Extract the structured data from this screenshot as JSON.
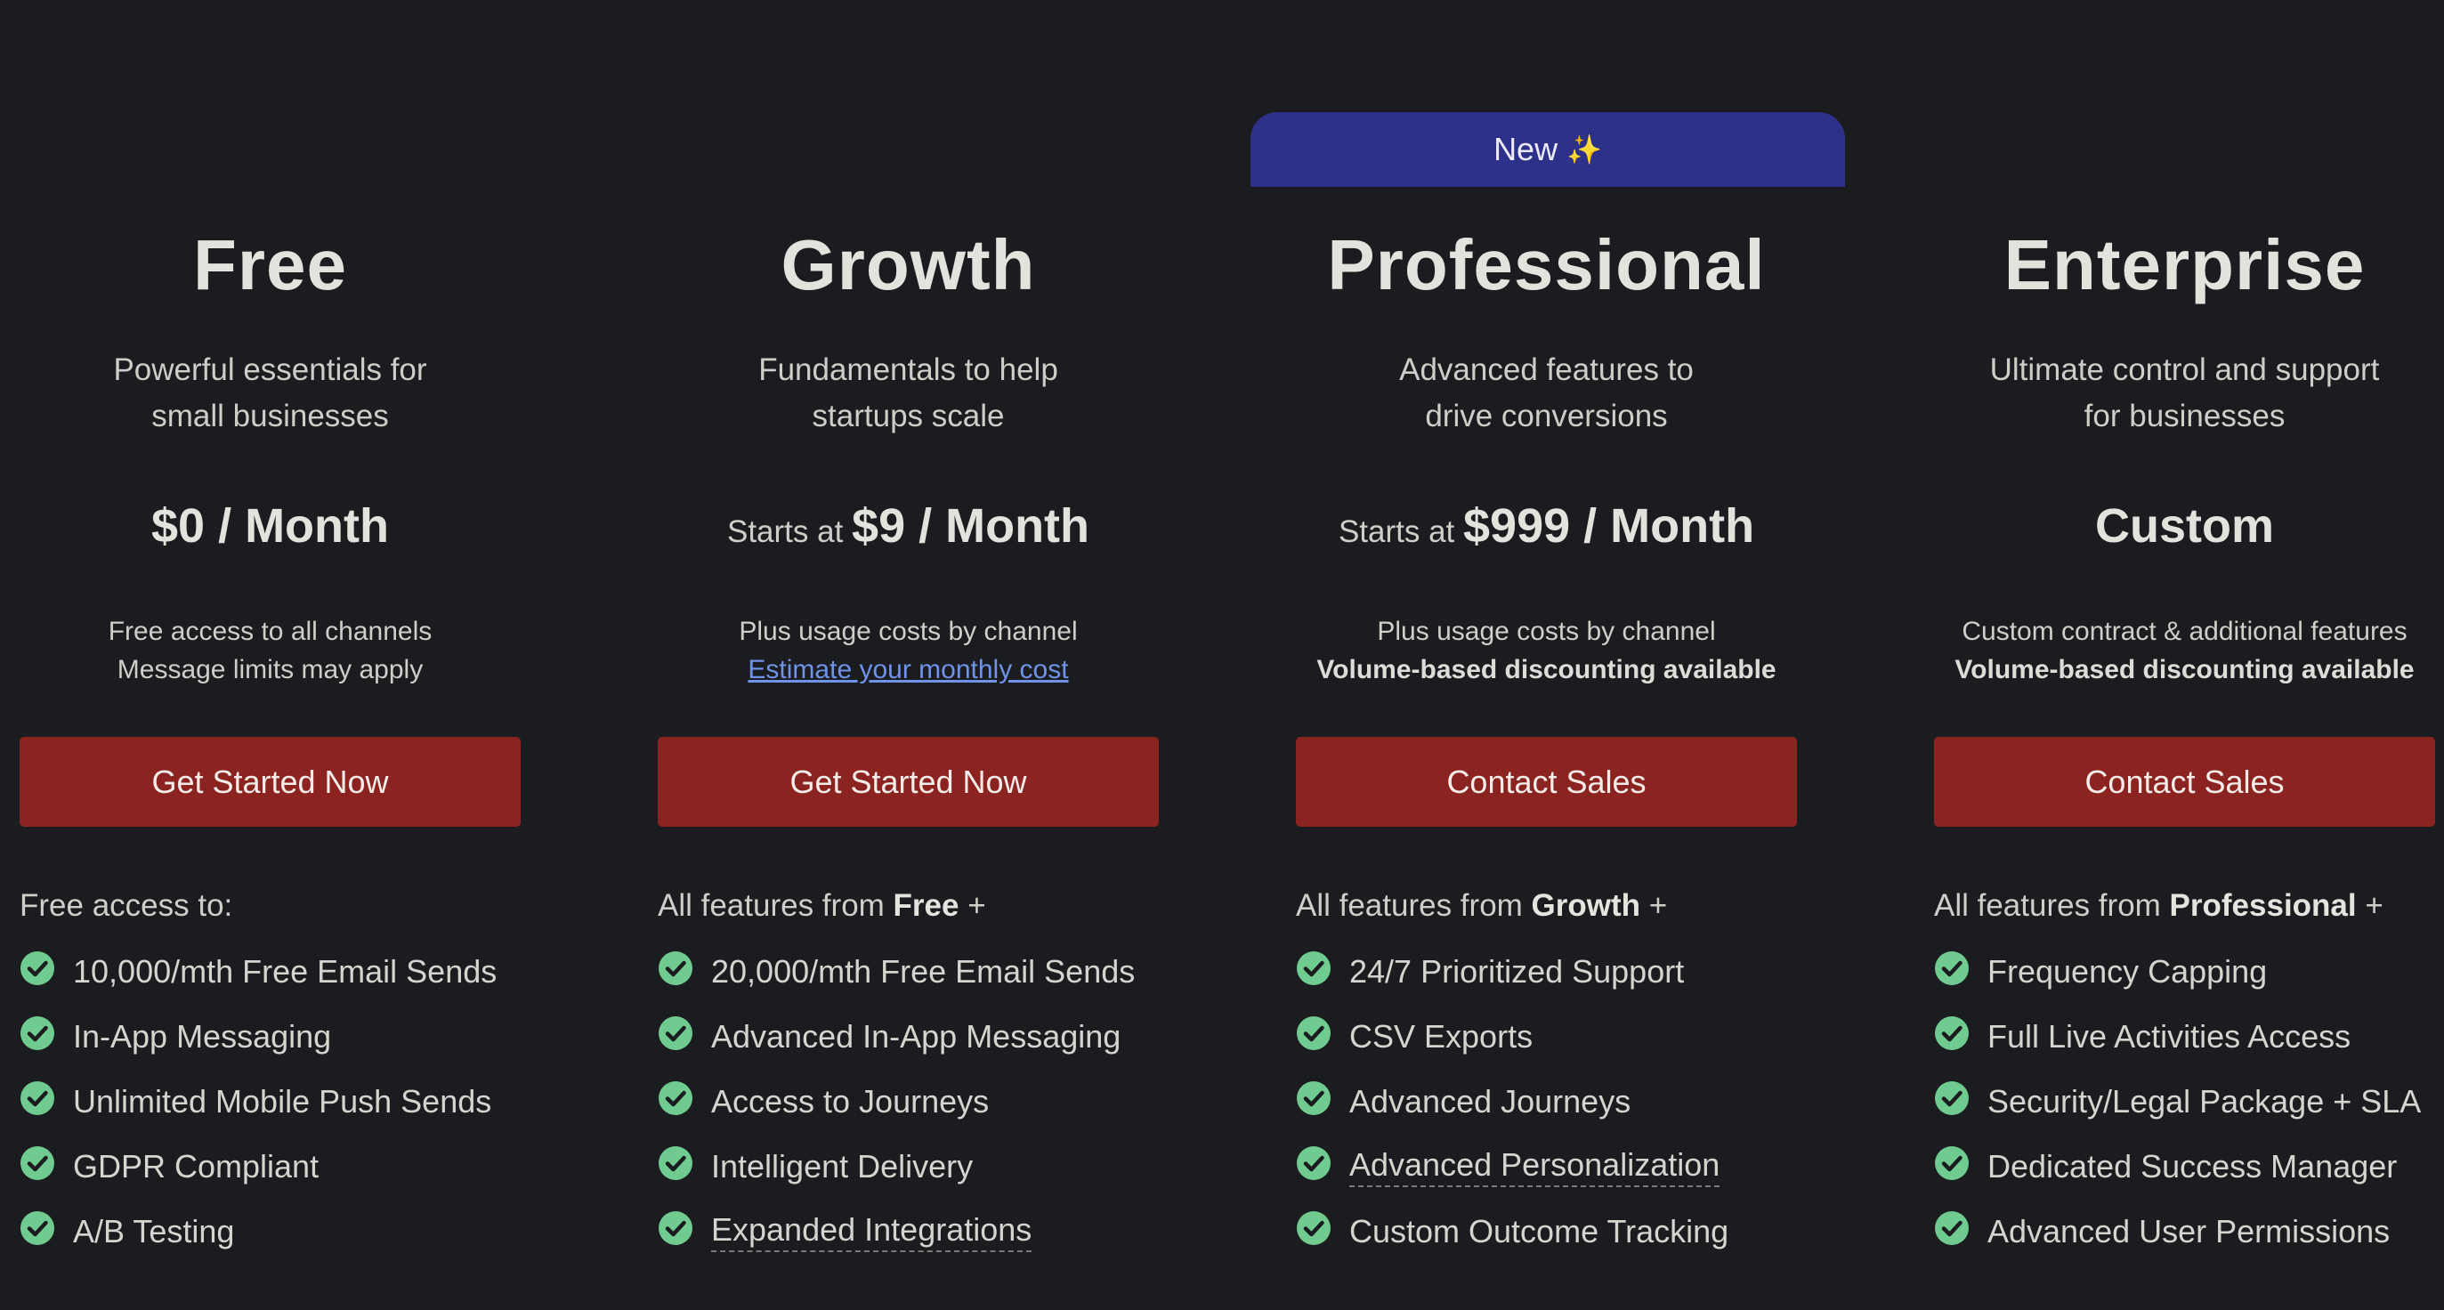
{
  "plans": [
    {
      "name": "Free",
      "desc_line1": "Powerful essentials for",
      "desc_line2": "small businesses",
      "price_prefix": "",
      "price_amount": "$0 / Month",
      "note_line1": "Free access to all channels",
      "note_line2": "Message limits may apply",
      "cta": "Get Started Now",
      "features_intro": "Free access to:",
      "features_intro_bold": "",
      "features_intro_suffix": "",
      "features": [
        "10,000/mth Free Email Sends",
        "In-App Messaging",
        "Unlimited Mobile Push Sends",
        "GDPR Compliant",
        "A/B Testing"
      ]
    },
    {
      "name": "Growth",
      "desc_line1": "Fundamentals to help",
      "desc_line2": "startups scale",
      "price_prefix": "Starts at ",
      "price_amount": "$9 / Month",
      "note_line1": "Plus usage costs by channel",
      "note_link": "Estimate your monthly cost",
      "cta": "Get Started Now",
      "features_intro": "All features from ",
      "features_intro_bold": "Free",
      "features_intro_suffix": " +",
      "features": [
        "20,000/mth Free Email Sends",
        "Advanced In-App Messaging",
        "Access to Journeys",
        "Intelligent Delivery",
        "Expanded Integrations"
      ]
    },
    {
      "badge": "New",
      "badge_icon": "sparkles-icon",
      "badge_glyph": "✨",
      "name": "Professional",
      "desc_line1": "Advanced features to",
      "desc_line2": "drive conversions",
      "price_prefix": "Starts at ",
      "price_amount": "$999 / Month",
      "note_line1": "Plus usage costs by channel",
      "note_line2": "Volume-based discounting available",
      "cta": "Contact Sales",
      "features_intro": "All features from ",
      "features_intro_bold": "Growth",
      "features_intro_suffix": " +",
      "features": [
        "24/7 Prioritized Support",
        "CSV Exports",
        "Advanced Journeys",
        "Advanced Personalization",
        "Custom Outcome Tracking"
      ]
    },
    {
      "name": "Enterprise",
      "desc_line1": "Ultimate control and support",
      "desc_line2": "for businesses",
      "price_prefix": "",
      "price_amount": "Custom",
      "note_line1": "Custom contract & additional features",
      "note_line2": "Volume-based discounting available",
      "cta": "Contact Sales",
      "features_intro": "All features from ",
      "features_intro_bold": "Professional",
      "features_intro_suffix": " +",
      "features": [
        "Frequency Capping",
        "Full Live Activities Access",
        "Security/Legal Package + SLA",
        "Dedicated Success Manager",
        "Advanced User Permissions"
      ]
    }
  ],
  "colors": {
    "background": "#1b1c1f",
    "cta": "#8b2421",
    "badge": "#2e3189",
    "check": "#6fcb8f",
    "link": "#6f93e8"
  },
  "icons": {
    "feature_check": "check-circle-icon"
  }
}
